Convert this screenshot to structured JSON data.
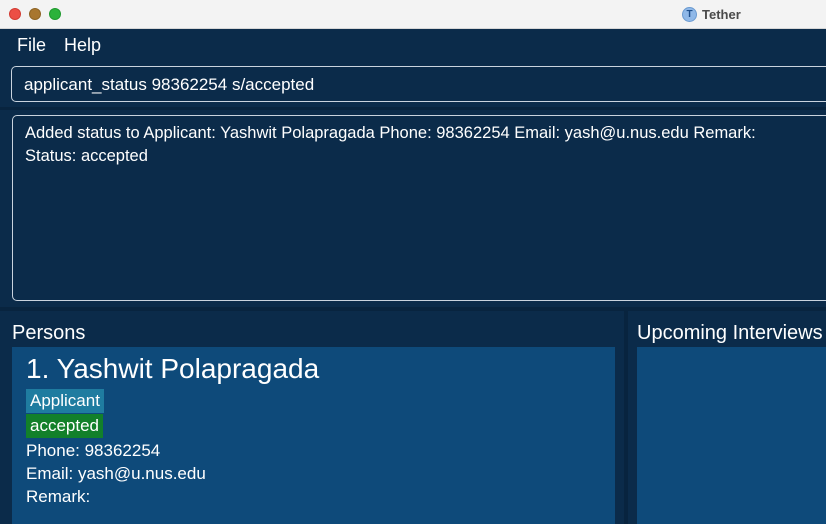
{
  "window": {
    "title": "Tether",
    "app_icon_glyph": "T"
  },
  "menu": {
    "items": [
      "File",
      "Help"
    ]
  },
  "command": {
    "value": "applicant_status 98362254 s/accepted"
  },
  "result": {
    "lines": [
      "Added status to Applicant: Yashwit Polapragada Phone: 98362254 Email: yash@u.nus.edu Remark:",
      "Status: accepted"
    ]
  },
  "persons": {
    "title": "Persons",
    "items": [
      {
        "name": "1.  Yashwit Polapragada",
        "role_tag": "Applicant",
        "status_tag": "accepted",
        "phone": "Phone: 98362254",
        "email": "Email: yash@u.nus.edu",
        "remark": "Remark:"
      }
    ]
  },
  "interviews": {
    "title": "Upcoming Interviews"
  },
  "colors": {
    "background": "#0b2b4a",
    "card": "#0e4a7a",
    "role_tag": "#1f7ca0",
    "status_tag": "#12802a"
  }
}
